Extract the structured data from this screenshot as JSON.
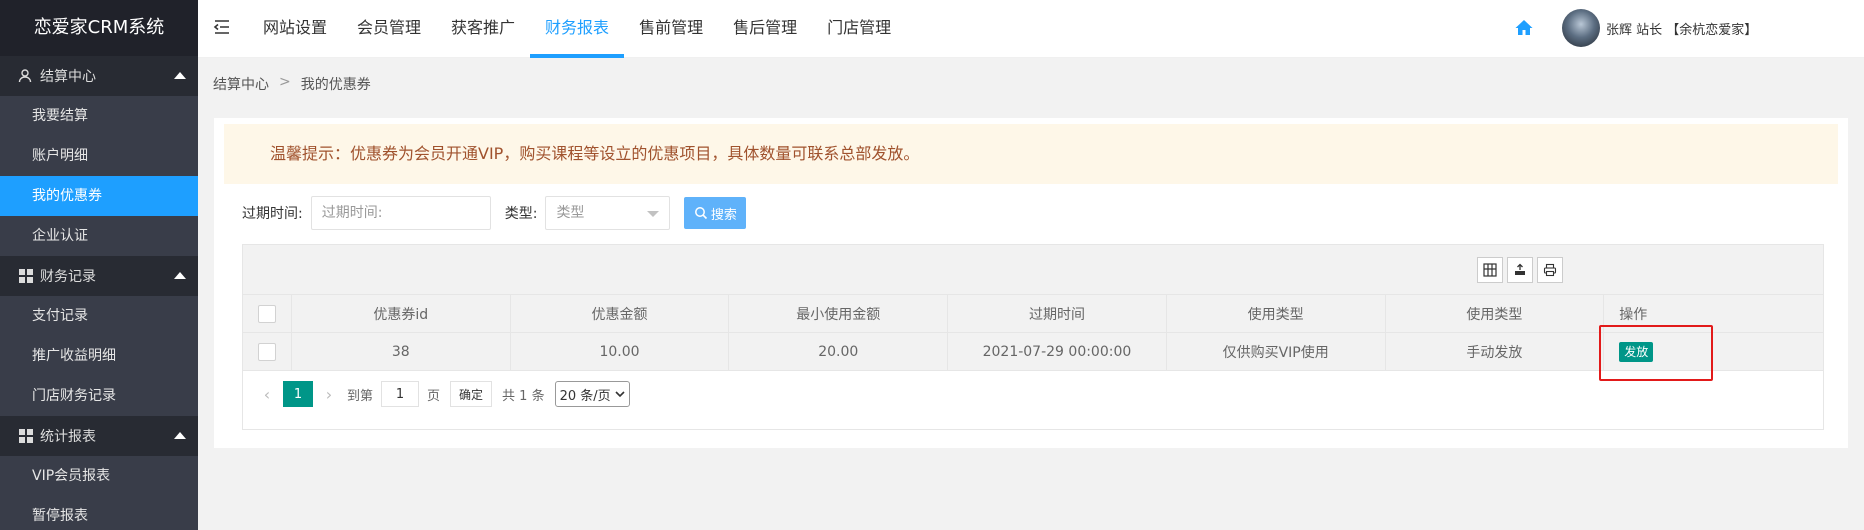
{
  "app": {
    "title": "恋爱家CRM系统"
  },
  "sidebar": {
    "groups": [
      {
        "label": "结算中心",
        "items": [
          "我要结算",
          "账户明细",
          "我的优惠券",
          "企业认证"
        ]
      },
      {
        "label": "财务记录",
        "items": [
          "支付记录",
          "推广收益明细",
          "门店财务记录"
        ]
      },
      {
        "label": "统计报表",
        "items": [
          "VIP会员报表",
          "暂停报表"
        ]
      }
    ],
    "active_item": "我的优惠券"
  },
  "topnav": {
    "items": [
      "网站设置",
      "会员管理",
      "获客推广",
      "财务报表",
      "售前管理",
      "售后管理",
      "门店管理"
    ],
    "active": "财务报表"
  },
  "user": {
    "label": "张辉 站长 【余杭恋爱家】"
  },
  "breadcrumb": {
    "root": "结算中心",
    "sep": ">",
    "current": "我的优惠券"
  },
  "tip": {
    "text": "温馨提示：优惠券为会员开通VIP，购买课程等设立的优惠项目，具体数量可联系总部发放。"
  },
  "filter": {
    "expire_label": "过期时间:",
    "expire_placeholder": "过期时间:",
    "type_label": "类型:",
    "type_value": "类型",
    "search_label": "搜索"
  },
  "table": {
    "columns": [
      "优惠券id",
      "优惠金额",
      "最小使用金额",
      "过期时间",
      "使用类型",
      "使用类型",
      "操作"
    ],
    "rows": [
      {
        "id": "38",
        "amount": "10.00",
        "min_amount": "20.00",
        "expire": "2021-07-29 00:00:00",
        "use_type": "仅供购买VIP使用",
        "issue_type": "手动发放",
        "action": "发放"
      }
    ]
  },
  "pager": {
    "prev": "‹",
    "current": "1",
    "next": "›",
    "goto_label": "到第",
    "goto_value": "1",
    "page_unit": "页",
    "confirm": "确定",
    "total": "共 1 条",
    "page_size": "20 条/页"
  },
  "colors": {
    "accent": "#1e9fff",
    "sidebar": "#393d49",
    "primary_button": "#009688",
    "highlight": "#e21a1a"
  }
}
